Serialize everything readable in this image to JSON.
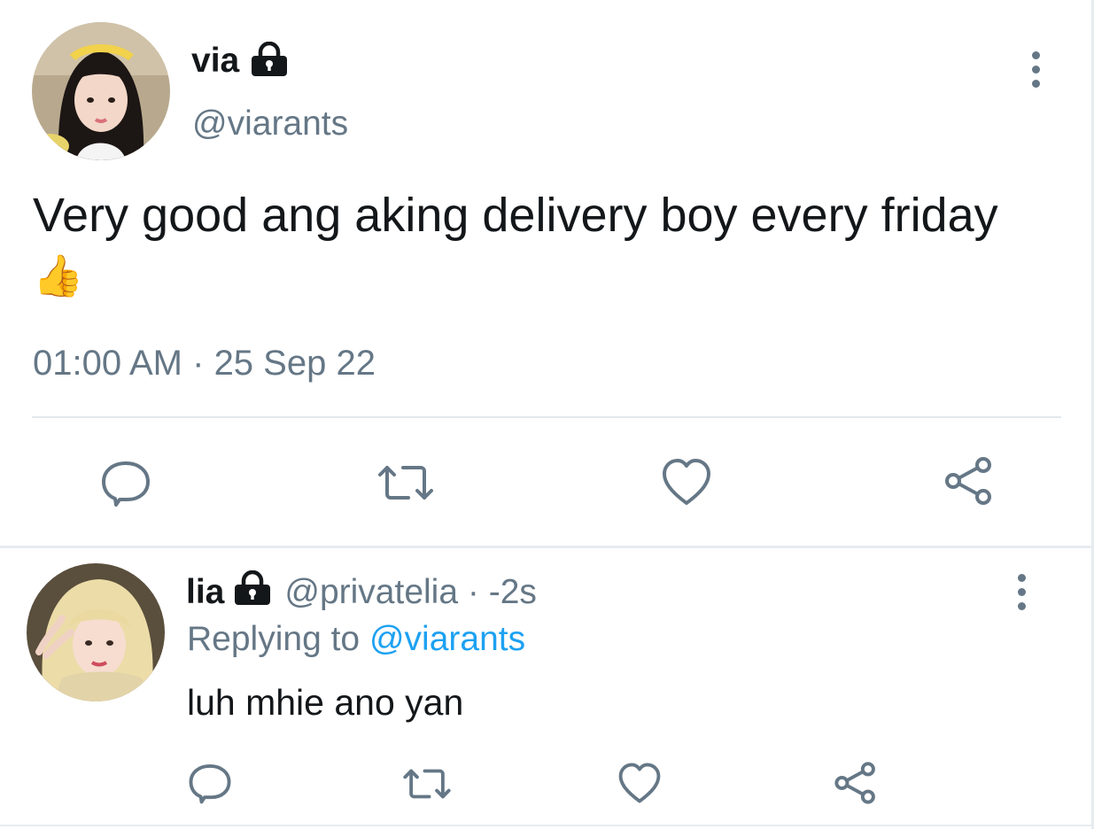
{
  "tweet": {
    "display_name": "via",
    "handle": "@viarants",
    "text": "Very good ang aking delivery boy every friday",
    "emoji": "👍",
    "time": "01:00 AM",
    "separator": " · ",
    "date": "25 Sep 22",
    "icons": {
      "lock": "lock-icon",
      "more": "more-vertical-icon",
      "reply": "reply-icon",
      "retweet": "retweet-icon",
      "like": "heart-icon",
      "share": "share-icon"
    }
  },
  "reply": {
    "display_name": "lia",
    "handle": "@privatelia",
    "meta_sep": " · ",
    "age": "-2s",
    "replying_prefix": "Replying to ",
    "replying_to": "@viarants",
    "text": "luh mhie ano yan"
  },
  "colors": {
    "text": "#14171a",
    "muted": "#657786",
    "link": "#1da1f2",
    "divider": "#e1e8ed"
  }
}
